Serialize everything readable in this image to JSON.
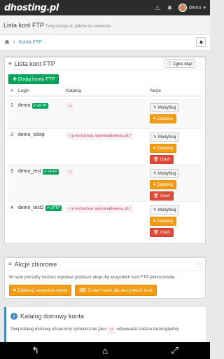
{
  "topbar": {
    "logo": "dhosting.pl",
    "warning_icon": "warning-icon",
    "notif_icon": "bell-icon",
    "user_name": "demo",
    "user_caret": "▾"
  },
  "page": {
    "title": "Lista kont FTP",
    "subtitle": "Twój dostęp do plików na serwerze"
  },
  "breadcrumb": {
    "home_icon": "home-icon",
    "separator": "›",
    "current": "Konta FTP"
  },
  "ftp_box": {
    "title": "Lista kont FTP",
    "report_label": "Zgłoś błąd",
    "add_button": "Dodaj konto FTP",
    "headers": {
      "num": "#",
      "login": "Login",
      "catalog": "Katalog",
      "actions": "Akcje"
    },
    "rows": [
      {
        "num": "1",
        "login": "demo",
        "badge": "oFTP",
        "path": "~/",
        "modify": "Modyfikuj",
        "block": "Zablokuj",
        "delete": ""
      },
      {
        "num": "2",
        "login": "demo_sklep",
        "badge": "",
        "path": "~/prestashop.wybranadomena.pl/",
        "modify": "Modyfikuj",
        "block": "Zablokuj",
        "delete": "Usuń"
      },
      {
        "num": "3",
        "login": "demo_test",
        "badge": "oFTP",
        "path": "~/",
        "modify": "Modyfikuj",
        "block": "Zablokuj",
        "delete": "Usuń"
      },
      {
        "num": "4",
        "login": "demo_test2",
        "badge": "oFTP",
        "path": "~/prestashop.wybranadomena.pl/",
        "modify": "Modyfikuj",
        "block": "Zablokuj",
        "delete": "Usuń"
      }
    ]
  },
  "bulk_box": {
    "title": "Akcje zbiorowe",
    "text": "W razie potrzeby możesz wykonać poniższe akcje dla wszystkich kont FTP jednocześnie.",
    "block_all": "Zablokuj wszystkie konta",
    "change_pass_all": "Zmień hasło dla wszystkich kont"
  },
  "home_callout": {
    "title": "Katalog domowy konta",
    "text_prefix": "Twój katalog domowy oznaczony symbolicznie jako",
    "symbol": "~/",
    "text_suffix": "odpowiada ścieżce bezwzględnej"
  },
  "android_nav": {
    "back": "↰",
    "home": "⌂",
    "recent": "⤢"
  },
  "colors": {
    "topbar": "#2c2c2c",
    "green": "#00a65a",
    "orange": "#f39c12",
    "red": "#dd4b39",
    "link": "#3c8dbc"
  }
}
